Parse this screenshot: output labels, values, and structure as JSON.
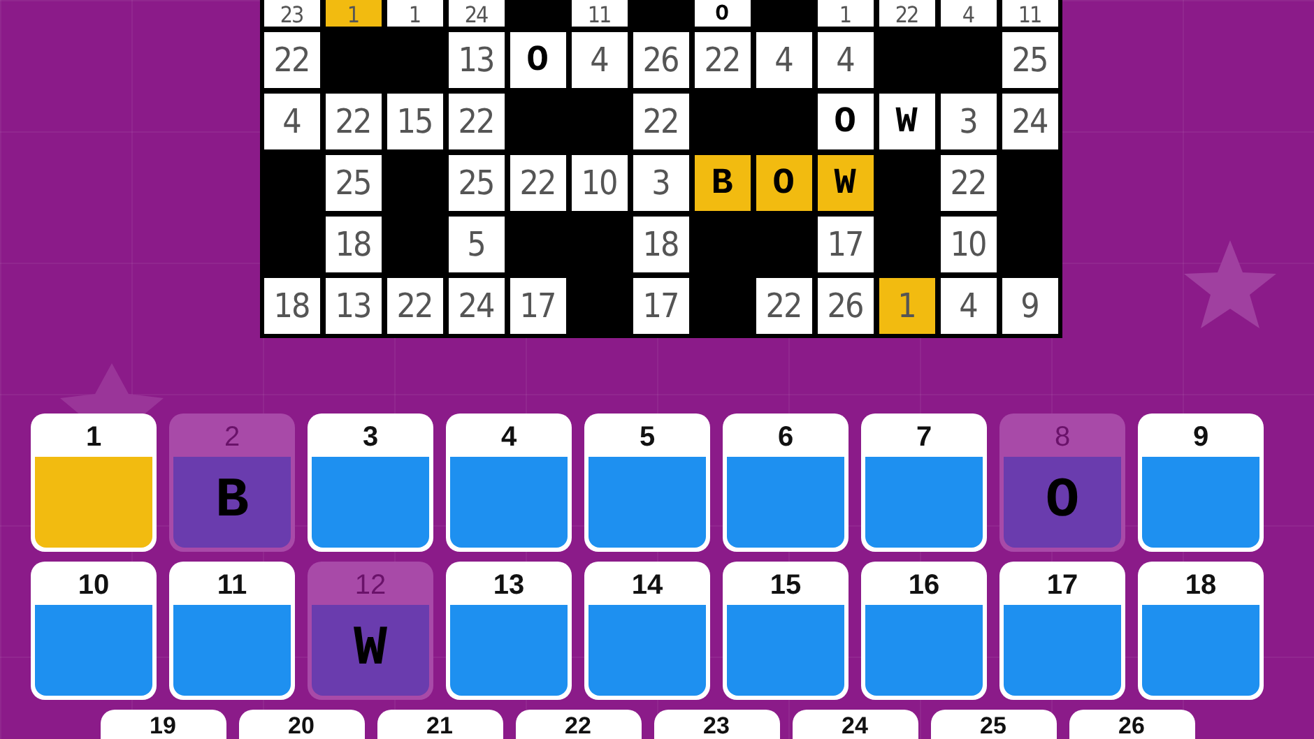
{
  "grid": {
    "rows": [
      [
        {
          "kind": "number",
          "text": "23",
          "highlighted": false
        },
        {
          "kind": "number",
          "text": "1",
          "highlighted": true
        },
        {
          "kind": "number",
          "text": "1",
          "highlighted": false
        },
        {
          "kind": "number",
          "text": "24",
          "highlighted": false
        },
        {
          "kind": "block"
        },
        {
          "kind": "number",
          "text": "11",
          "highlighted": false
        },
        {
          "kind": "block"
        },
        {
          "kind": "letter",
          "text": "O",
          "highlighted": false
        },
        {
          "kind": "block"
        },
        {
          "kind": "number",
          "text": "1",
          "highlighted": false
        },
        {
          "kind": "number",
          "text": "22",
          "highlighted": false
        },
        {
          "kind": "number",
          "text": "4",
          "highlighted": false
        },
        {
          "kind": "number",
          "text": "11",
          "highlighted": false
        }
      ],
      [
        {
          "kind": "number",
          "text": "22",
          "highlighted": false
        },
        {
          "kind": "block"
        },
        {
          "kind": "block"
        },
        {
          "kind": "number",
          "text": "13",
          "highlighted": false
        },
        {
          "kind": "letter",
          "text": "O",
          "highlighted": false
        },
        {
          "kind": "number",
          "text": "4",
          "highlighted": false
        },
        {
          "kind": "number",
          "text": "26",
          "highlighted": false
        },
        {
          "kind": "number",
          "text": "22",
          "highlighted": false
        },
        {
          "kind": "number",
          "text": "4",
          "highlighted": false
        },
        {
          "kind": "number",
          "text": "4",
          "highlighted": false
        },
        {
          "kind": "block"
        },
        {
          "kind": "block"
        },
        {
          "kind": "number",
          "text": "25",
          "highlighted": false
        }
      ],
      [
        {
          "kind": "number",
          "text": "4",
          "highlighted": false
        },
        {
          "kind": "number",
          "text": "22",
          "highlighted": false
        },
        {
          "kind": "number",
          "text": "15",
          "highlighted": false
        },
        {
          "kind": "number",
          "text": "22",
          "highlighted": false
        },
        {
          "kind": "block"
        },
        {
          "kind": "block"
        },
        {
          "kind": "number",
          "text": "22",
          "highlighted": false
        },
        {
          "kind": "block"
        },
        {
          "kind": "block"
        },
        {
          "kind": "letter",
          "text": "O",
          "highlighted": false
        },
        {
          "kind": "letter",
          "text": "W",
          "highlighted": false
        },
        {
          "kind": "number",
          "text": "3",
          "highlighted": false
        },
        {
          "kind": "number",
          "text": "24",
          "highlighted": false
        }
      ],
      [
        {
          "kind": "block"
        },
        {
          "kind": "number",
          "text": "25",
          "highlighted": false
        },
        {
          "kind": "block"
        },
        {
          "kind": "number",
          "text": "25",
          "highlighted": false
        },
        {
          "kind": "number",
          "text": "22",
          "highlighted": false
        },
        {
          "kind": "number",
          "text": "10",
          "highlighted": false
        },
        {
          "kind": "number",
          "text": "3",
          "highlighted": false
        },
        {
          "kind": "letter",
          "text": "B",
          "highlighted": true
        },
        {
          "kind": "letter",
          "text": "O",
          "highlighted": true
        },
        {
          "kind": "letter",
          "text": "W",
          "highlighted": true
        },
        {
          "kind": "block"
        },
        {
          "kind": "number",
          "text": "22",
          "highlighted": false
        },
        {
          "kind": "block"
        }
      ],
      [
        {
          "kind": "block"
        },
        {
          "kind": "number",
          "text": "18",
          "highlighted": false
        },
        {
          "kind": "block"
        },
        {
          "kind": "number",
          "text": "5",
          "highlighted": false
        },
        {
          "kind": "block"
        },
        {
          "kind": "block"
        },
        {
          "kind": "number",
          "text": "18",
          "highlighted": false
        },
        {
          "kind": "block"
        },
        {
          "kind": "block"
        },
        {
          "kind": "number",
          "text": "17",
          "highlighted": false
        },
        {
          "kind": "block"
        },
        {
          "kind": "number",
          "text": "10",
          "highlighted": false
        },
        {
          "kind": "block"
        }
      ],
      [
        {
          "kind": "number",
          "text": "18",
          "highlighted": false
        },
        {
          "kind": "number",
          "text": "13",
          "highlighted": false
        },
        {
          "kind": "number",
          "text": "22",
          "highlighted": false
        },
        {
          "kind": "number",
          "text": "24",
          "highlighted": false
        },
        {
          "kind": "number",
          "text": "17",
          "highlighted": false
        },
        {
          "kind": "block"
        },
        {
          "kind": "number",
          "text": "17",
          "highlighted": false
        },
        {
          "kind": "block"
        },
        {
          "kind": "number",
          "text": "22",
          "highlighted": false
        },
        {
          "kind": "number",
          "text": "26",
          "highlighted": false
        },
        {
          "kind": "number",
          "text": "1",
          "highlighted": true
        },
        {
          "kind": "number",
          "text": "4",
          "highlighted": false
        },
        {
          "kind": "number",
          "text": "9",
          "highlighted": false
        }
      ]
    ]
  },
  "keyboard": {
    "rows": [
      [
        {
          "number": "1",
          "kind": "open",
          "selected": true
        },
        {
          "number": "2",
          "kind": "solved",
          "letter": "B",
          "selected": false
        },
        {
          "number": "3",
          "kind": "open",
          "selected": false
        },
        {
          "number": "4",
          "kind": "open",
          "selected": false
        },
        {
          "number": "5",
          "kind": "open",
          "selected": false
        },
        {
          "number": "6",
          "kind": "open",
          "selected": false
        },
        {
          "number": "7",
          "kind": "open",
          "selected": false
        },
        {
          "number": "8",
          "kind": "solved",
          "letter": "O",
          "selected": false
        },
        {
          "number": "9",
          "kind": "open",
          "selected": false
        }
      ],
      [
        {
          "number": "10",
          "kind": "open",
          "selected": false
        },
        {
          "number": "11",
          "kind": "open",
          "selected": false
        },
        {
          "number": "12",
          "kind": "solved",
          "letter": "W",
          "selected": false
        },
        {
          "number": "13",
          "kind": "open",
          "selected": false
        },
        {
          "number": "14",
          "kind": "open",
          "selected": false
        },
        {
          "number": "15",
          "kind": "open",
          "selected": false
        },
        {
          "number": "16",
          "kind": "open",
          "selected": false
        },
        {
          "number": "17",
          "kind": "open",
          "selected": false
        },
        {
          "number": "18",
          "kind": "open",
          "selected": false
        }
      ],
      [
        {
          "number": "19",
          "kind": "open",
          "selected": false
        },
        {
          "number": "20",
          "kind": "open",
          "selected": false
        },
        {
          "number": "21",
          "kind": "open",
          "selected": false
        },
        {
          "number": "22",
          "kind": "open",
          "selected": false
        },
        {
          "number": "23",
          "kind": "open",
          "selected": false
        },
        {
          "number": "24",
          "kind": "open",
          "selected": false
        },
        {
          "number": "25",
          "kind": "open",
          "selected": false
        },
        {
          "number": "26",
          "kind": "open",
          "selected": false
        }
      ]
    ]
  }
}
